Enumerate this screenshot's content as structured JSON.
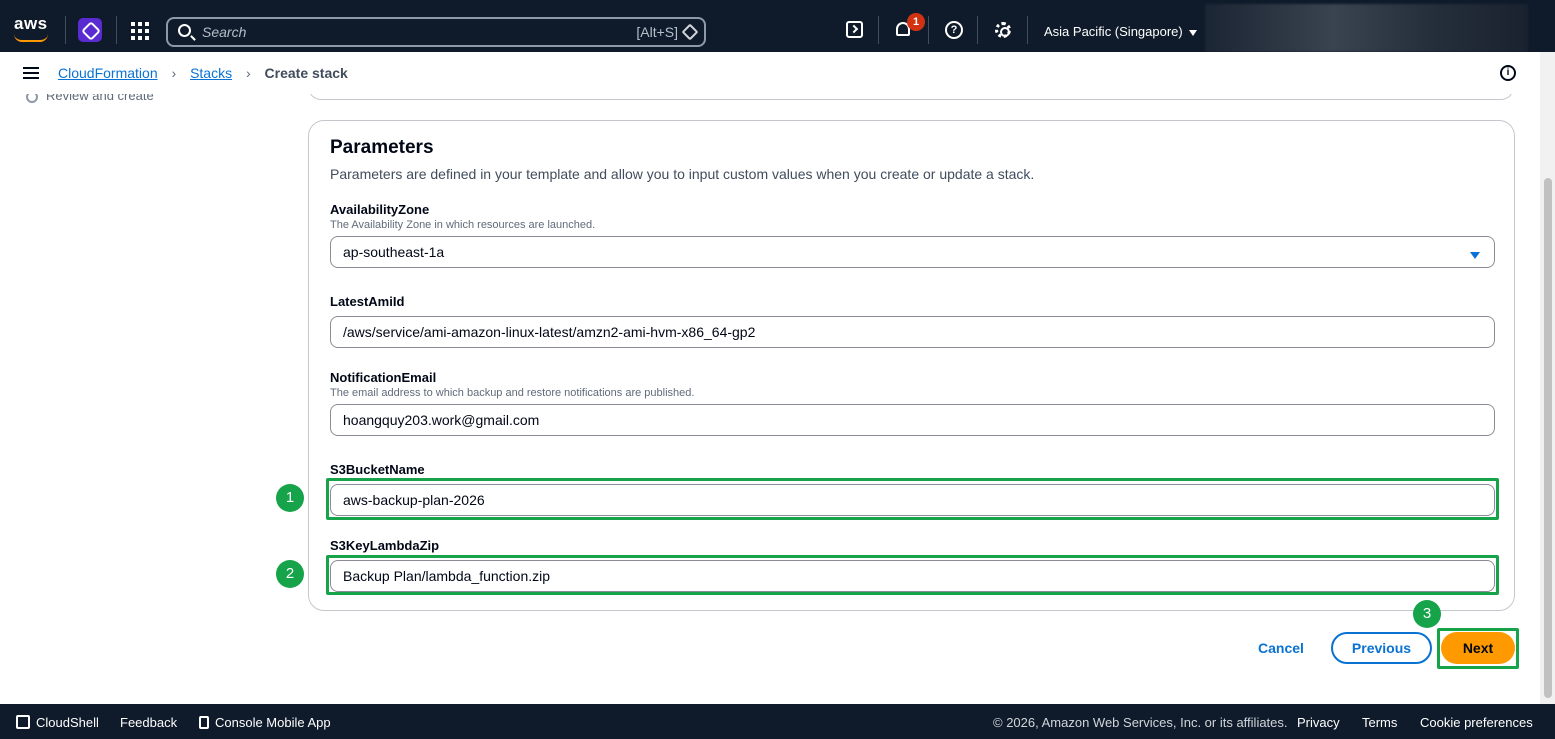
{
  "topbar": {
    "logo_text": "aws",
    "search_placeholder": "Search",
    "search_shortcut": "[Alt+S]",
    "notifications_count": "1",
    "help_glyph": "?",
    "region": "Asia Pacific (Singapore)"
  },
  "breadcrumb": {
    "items": [
      "CloudFormation",
      "Stacks"
    ],
    "current": "Create stack"
  },
  "wizard": {
    "review_step": "Review and create"
  },
  "parameters": {
    "title": "Parameters",
    "description": "Parameters are defined in your template and allow you to input custom values when you create or update a stack.",
    "fields": [
      {
        "label": "AvailabilityZone",
        "hint": "The Availability Zone in which resources are launched.",
        "value": "ap-southeast-1a"
      },
      {
        "label": "LatestAmiId",
        "hint": "",
        "value": "/aws/service/ami-amazon-linux-latest/amzn2-ami-hvm-x86_64-gp2"
      },
      {
        "label": "NotificationEmail",
        "hint": "The email address to which backup and restore notifications are published.",
        "value": "hoangquy203.work@gmail.com"
      },
      {
        "label": "S3BucketName",
        "hint": "",
        "value": "aws-backup-plan-2026"
      },
      {
        "label": "S3KeyLambdaZip",
        "hint": "",
        "value": "Backup Plan/lambda_function.zip"
      }
    ]
  },
  "annotations": [
    "1",
    "2",
    "3"
  ],
  "actions": {
    "cancel": "Cancel",
    "previous": "Previous",
    "next": "Next"
  },
  "footer": {
    "cloudshell": "CloudShell",
    "feedback": "Feedback",
    "mobile_app": "Console Mobile App",
    "copyright": "© 2026, Amazon Web Services, Inc. or its affiliates.",
    "privacy": "Privacy",
    "terms": "Terms",
    "cookies": "Cookie preferences"
  },
  "colors": {
    "topbar_bg": "#0f1b2a",
    "link": "#0972d3",
    "primary_button": "#ff9900",
    "annotation_green": "#16a34a",
    "badge_red": "#d13212"
  }
}
